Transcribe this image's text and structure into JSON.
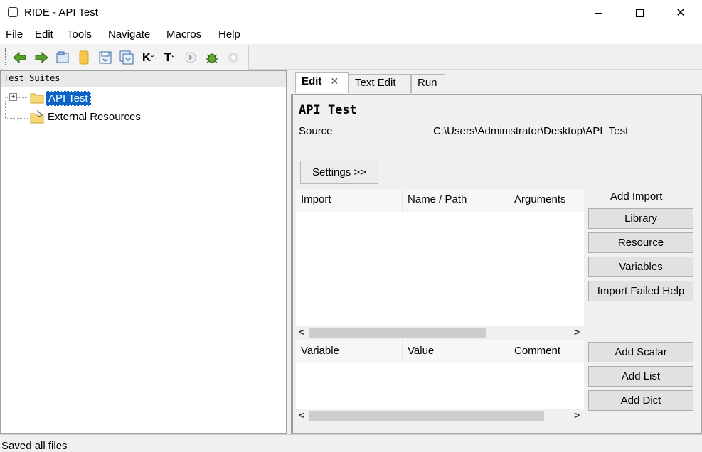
{
  "window": {
    "title": "RIDE - API Test",
    "minimize_glyph": "—",
    "close_glyph": "✕"
  },
  "menu": [
    "File",
    "Edit",
    "Tools",
    "Navigate",
    "Macros",
    "Help"
  ],
  "toolbar": {
    "icons": [
      "back-arrow-icon",
      "forward-arrow-icon",
      "open-suite-icon",
      "open-directory-icon",
      "save-icon",
      "save-all-icon",
      "search-keywords-icon",
      "search-tests-icon",
      "run-icon",
      "debug-bug-icon",
      "stop-icon"
    ],
    "glyphs": {
      "search_keywords": "K",
      "search_tests": "T",
      "search_badge": "°",
      "stop": "●",
      "run": "▶"
    },
    "colors": {
      "arrow": "#58a02a",
      "folder": "#f4c64e"
    }
  },
  "tree": {
    "header": "Test Suites",
    "expander": "+",
    "items": [
      {
        "label": "API Test",
        "selected": true
      },
      {
        "label": "External Resources",
        "selected": false
      }
    ],
    "selection_color": "#0a64c8"
  },
  "tabs": [
    {
      "label": "Edit",
      "active": true,
      "close": "✕"
    },
    {
      "label": "Text Edit",
      "active": false
    },
    {
      "label": "Run",
      "active": false
    }
  ],
  "editor": {
    "suite_name": "API Test",
    "source_label": "Source",
    "source_path": "C:\\Users\\Administrator\\Desktop\\API_Test",
    "settings_button": "Settings >>",
    "imports": {
      "columns": [
        "Import",
        "Name / Path",
        "Arguments"
      ],
      "add_label": "Add Import",
      "buttons": [
        "Library",
        "Resource",
        "Variables",
        "Import Failed Help"
      ]
    },
    "variables": {
      "columns": [
        "Variable",
        "Value",
        "Comment"
      ],
      "buttons": [
        "Add Scalar",
        "Add List",
        "Add Dict"
      ]
    },
    "scroll_left": "<",
    "scroll_right": ">"
  },
  "status": "Saved all files"
}
